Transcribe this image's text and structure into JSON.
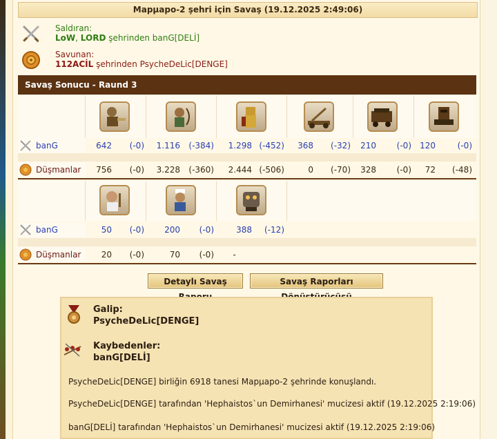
{
  "title": "Марµаро-2 şehri için Savaş (19.12.2025 2:49:06)",
  "attacker": {
    "label": "Saldıran:",
    "player1": "LoW",
    "sep": ", ",
    "player2": "LORD",
    "rest": " şehrinden banG[DELİ]"
  },
  "defender": {
    "label": "Savunan:",
    "city": "112ACİL",
    "rest": " şehrinden PsycheDeLic[DENGE]"
  },
  "round_title": "Savaş Sonucu - Raund 3",
  "table1": {
    "units": [
      "swordsman-unit",
      "archer-unit",
      "hoplite-unit",
      "catapult-unit",
      "ram-unit",
      "tower-unit"
    ],
    "attacker_name": "banG",
    "attacker": [
      {
        "count": "642",
        "loss": "(-0)"
      },
      {
        "count": "1.116",
        "loss": "(-384)"
      },
      {
        "count": "1.298",
        "loss": "(-452)"
      },
      {
        "count": "368",
        "loss": "(-32)"
      },
      {
        "count": "210",
        "loss": "(-0)"
      },
      {
        "count": "120",
        "loss": "(-0)"
      }
    ],
    "defender_name": "Düşmanlar",
    "defender": [
      {
        "count": "756",
        "loss": "(-0)"
      },
      {
        "count": "3.228",
        "loss": "(-360)"
      },
      {
        "count": "2.444",
        "loss": "(-506)"
      },
      {
        "count": "0",
        "loss": "(-70)"
      },
      {
        "count": "328",
        "loss": "(-0)"
      },
      {
        "count": "72",
        "loss": "(-48)"
      }
    ]
  },
  "table2": {
    "units": [
      "cook-unit",
      "chef-unit",
      "steam-giant-unit"
    ],
    "attacker_name": "banG",
    "attacker": [
      {
        "count": "50",
        "loss": "(-0)"
      },
      {
        "count": "200",
        "loss": "(-0)"
      },
      {
        "count": "388",
        "loss": "(-12)"
      }
    ],
    "defender_name": "Düşmanlar",
    "defender": [
      {
        "count": "20",
        "loss": "(-0)"
      },
      {
        "count": "70",
        "loss": "(-0)"
      },
      {
        "count": "-",
        "loss": ""
      }
    ]
  },
  "buttons": {
    "detailed": "Detaylı Savaş Raporu",
    "converter": "Savaş Raporları Dönüştürücüsü"
  },
  "result": {
    "winner_label": "Galip:",
    "winner": "PsycheDeLic[DENGE]",
    "losers_label": "Kaybedenler:",
    "losers": "banG[DELİ]",
    "messages": [
      "PsycheDeLic[DENGE] birliğin 6918 tanesi Марµаро-2 şehrinde konuşlandı.",
      "PsycheDeLic[DENGE] tarafından 'Hephaistos`un Demirhanesi' mucizesi aktif (19.12.2025 2:19:06)",
      "banG[DELİ] tarafından 'Hephaistos`un Demirhanesi' mucizesi aktif (19.12.2025 2:19:06)"
    ]
  }
}
